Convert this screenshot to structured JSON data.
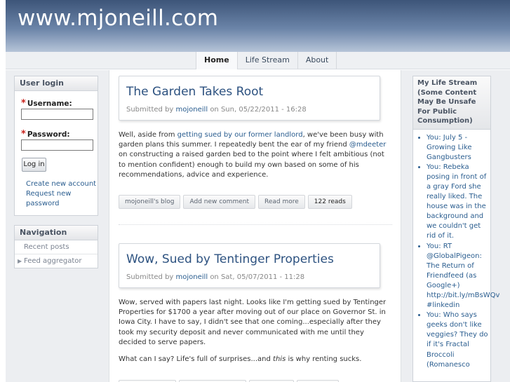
{
  "site": {
    "title": "www.mjoneill.com"
  },
  "nav": {
    "tabs": [
      "Home",
      "Life Stream",
      "About"
    ]
  },
  "login": {
    "title": "User login",
    "username_label": "Username:",
    "password_label": "Password:",
    "required_mark": "*",
    "button": "Log in",
    "create_link": "Create new account",
    "request_line1": "Request new",
    "request_line2": "password"
  },
  "navigation": {
    "title": "Navigation",
    "items": [
      "Recent posts",
      "Feed aggregator"
    ],
    "arrow": "▶"
  },
  "posts": [
    {
      "title": "The Garden Takes Root",
      "submitted_by": "Submitted by",
      "author": "mojoneill",
      "date": "on Sun, 05/22/2011 - 16:28",
      "body": {
        "t1": "Well, aside from ",
        "l1": "getting sued by our former landlord",
        "t2": ", we've been busy with garden plans this summer. I repeatedly bent the ear of my friend ",
        "l2": "@mdeeter",
        "t3": " on constructing a raised garden bed to the point where I felt ambitious (not to mention confident) enough to build my own based on some of his recommendations, advice and experience."
      },
      "links": [
        "mojoneill's blog",
        "Add new comment",
        "Read more",
        "122 reads"
      ]
    },
    {
      "title": "Wow, Sued by Tentinger Properties",
      "submitted_by": "Submitted by",
      "author": "mojoneill",
      "date": "on Sat, 05/07/2011 - 11:28",
      "body": {
        "p1": "Wow, served with papers last night. Looks like I'm getting sued by Tentinger Properties for $1700 a year after moving out of our place on Governor St. in Iowa City. I have to say, I didn't see that one coming...especially after they took my security deposit and never communicated with me until they decided to serve papers.",
        "p2a": "What can I say? Life's full of surprises...and ",
        "p2em": "this",
        "p2b": " is why renting sucks."
      }
    }
  ],
  "lifestream": {
    "title": "My Life Stream (Some Content May Be Unsafe For Public Consumption)",
    "items": [
      "You: July 5 - Growing Like Gangbusters",
      "You: Rebeka posing in front of a gray Ford she really liked. The house was in the background and we couldn't get rid of it.",
      "You: RT @GlobalPigeon: The Return of Friendfeed (as Google+) http://bit.ly/mBsWQv #linkedin",
      "You: Who says geeks don't like veggies? They do if it's Fractal Broccoli (Romanesco"
    ]
  }
}
